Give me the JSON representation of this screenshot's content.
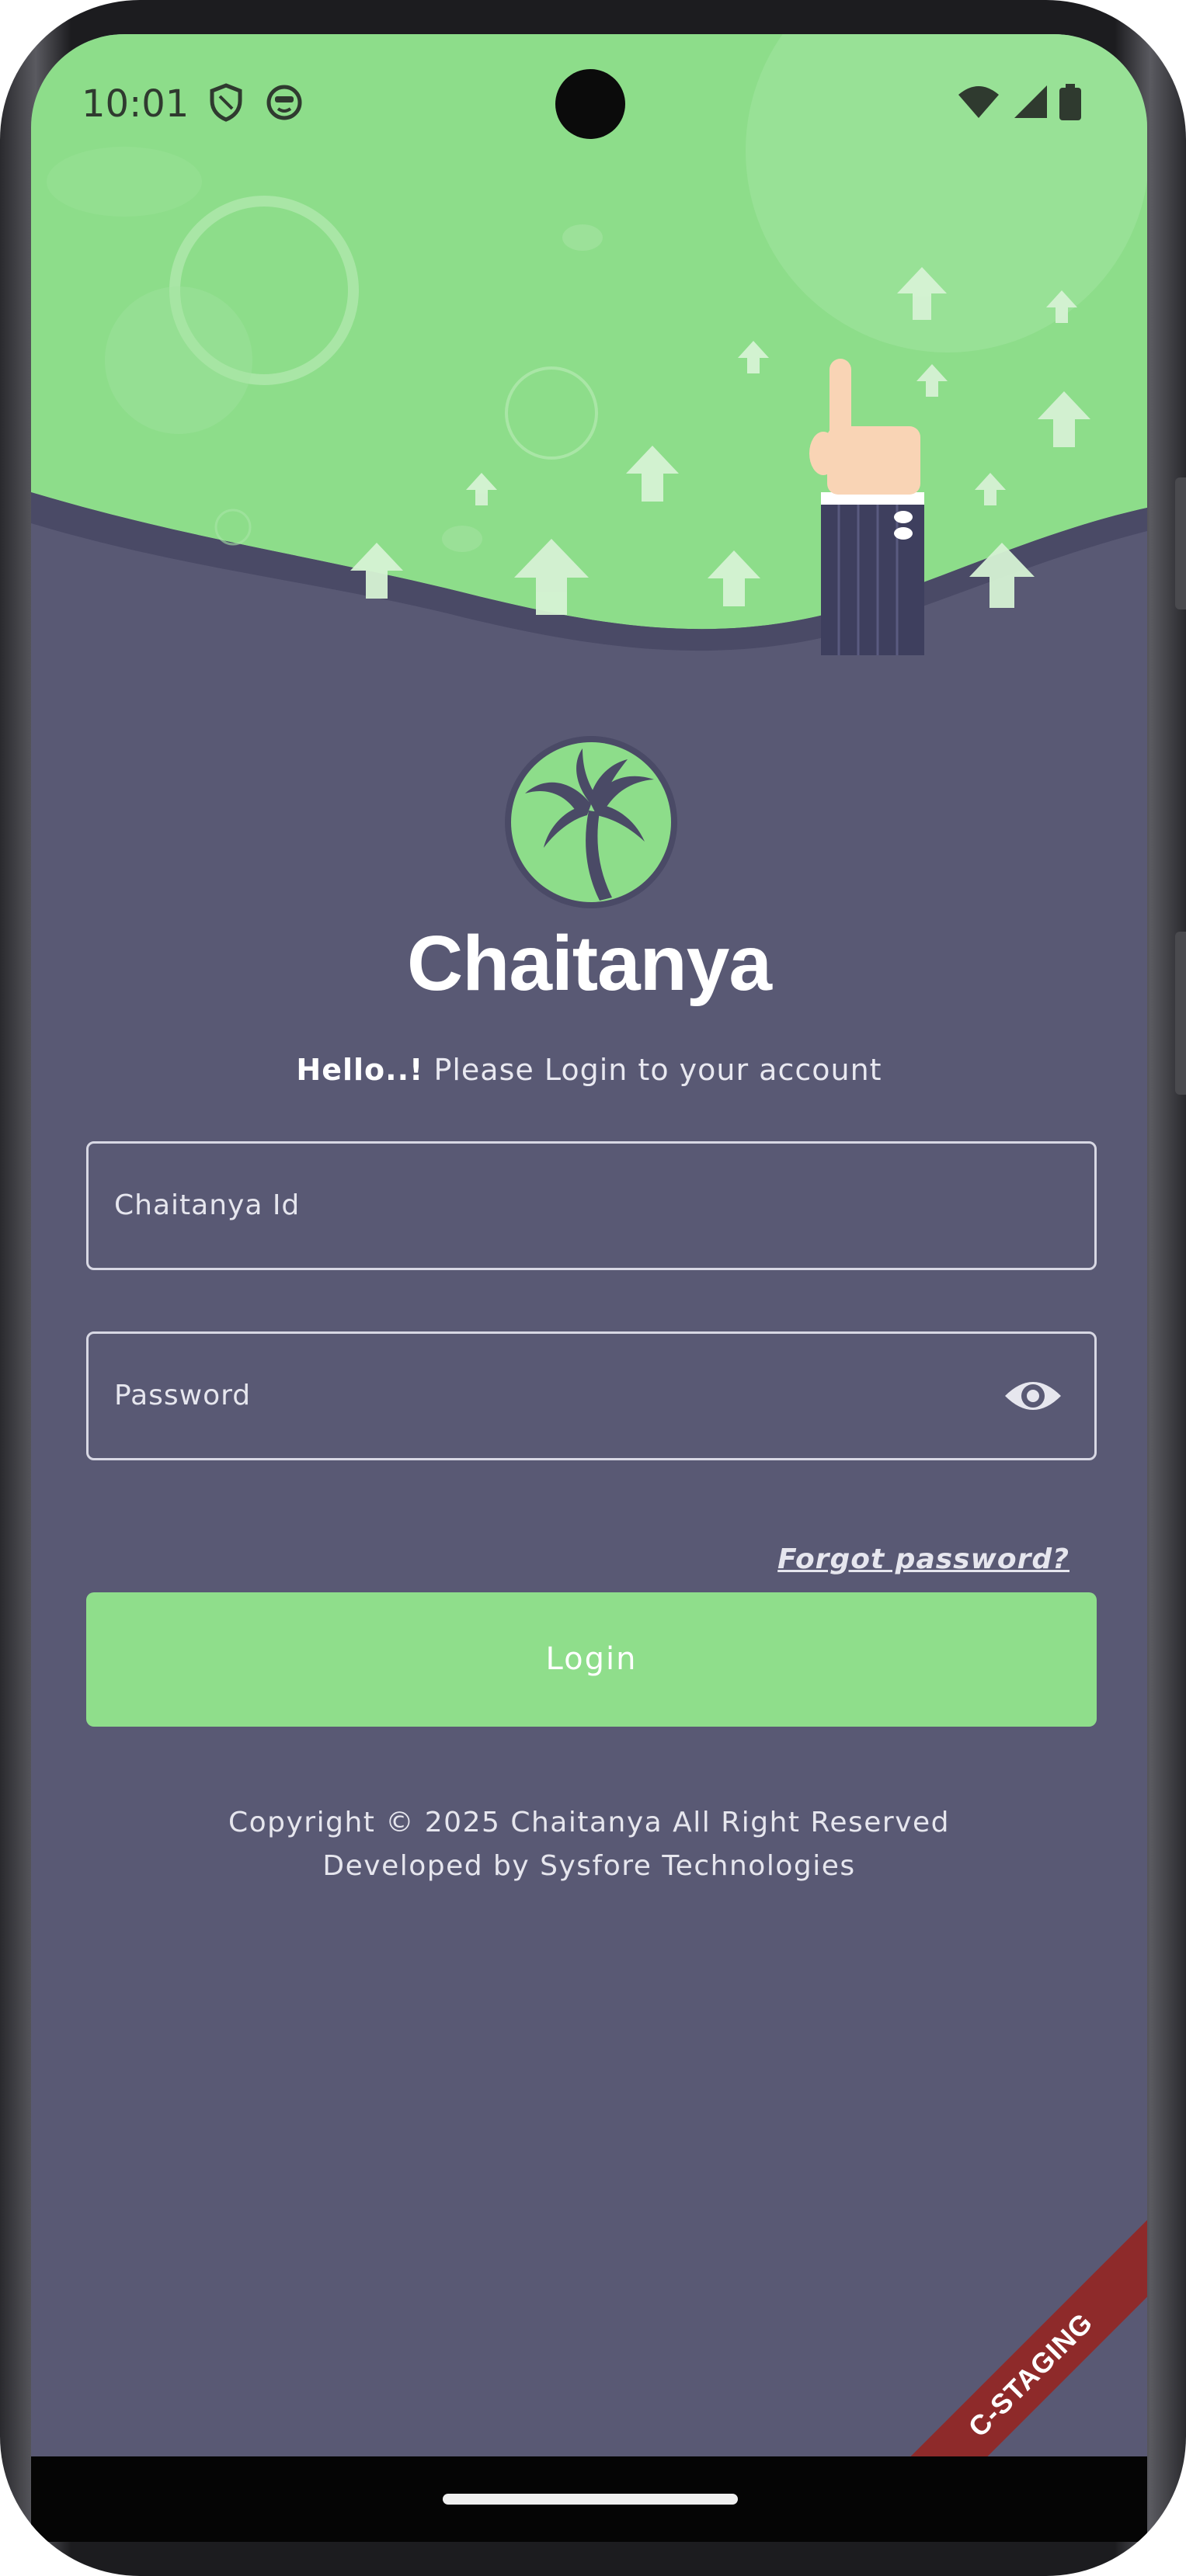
{
  "status_bar": {
    "time": "10:01",
    "left_icons": [
      "shield-icon",
      "face-icon"
    ],
    "right_icons": [
      "wifi-icon",
      "signal-icon",
      "battery-icon"
    ]
  },
  "app": {
    "title": "Chaitanya",
    "logo_icon": "palm-tree-icon",
    "greeting_bold": "Hello..!",
    "greeting_rest": " Please Login to your account"
  },
  "form": {
    "id_label": "Chaitanya Id",
    "password_label": "Password",
    "password_toggle_icon": "eye-icon",
    "forgot_password": "Forgot password?",
    "login_label": "Login"
  },
  "footer": {
    "copyright": "Copyright © 2025 Chaitanya All Right Reserved",
    "developer": "Developed by Sysfore Technologies"
  },
  "environment_badge": "C-STAGING",
  "colors": {
    "header_green": "#8ddd8a",
    "background": "#595974",
    "button_green": "#8fde8b",
    "ribbon_red": "#8e2a2a"
  }
}
